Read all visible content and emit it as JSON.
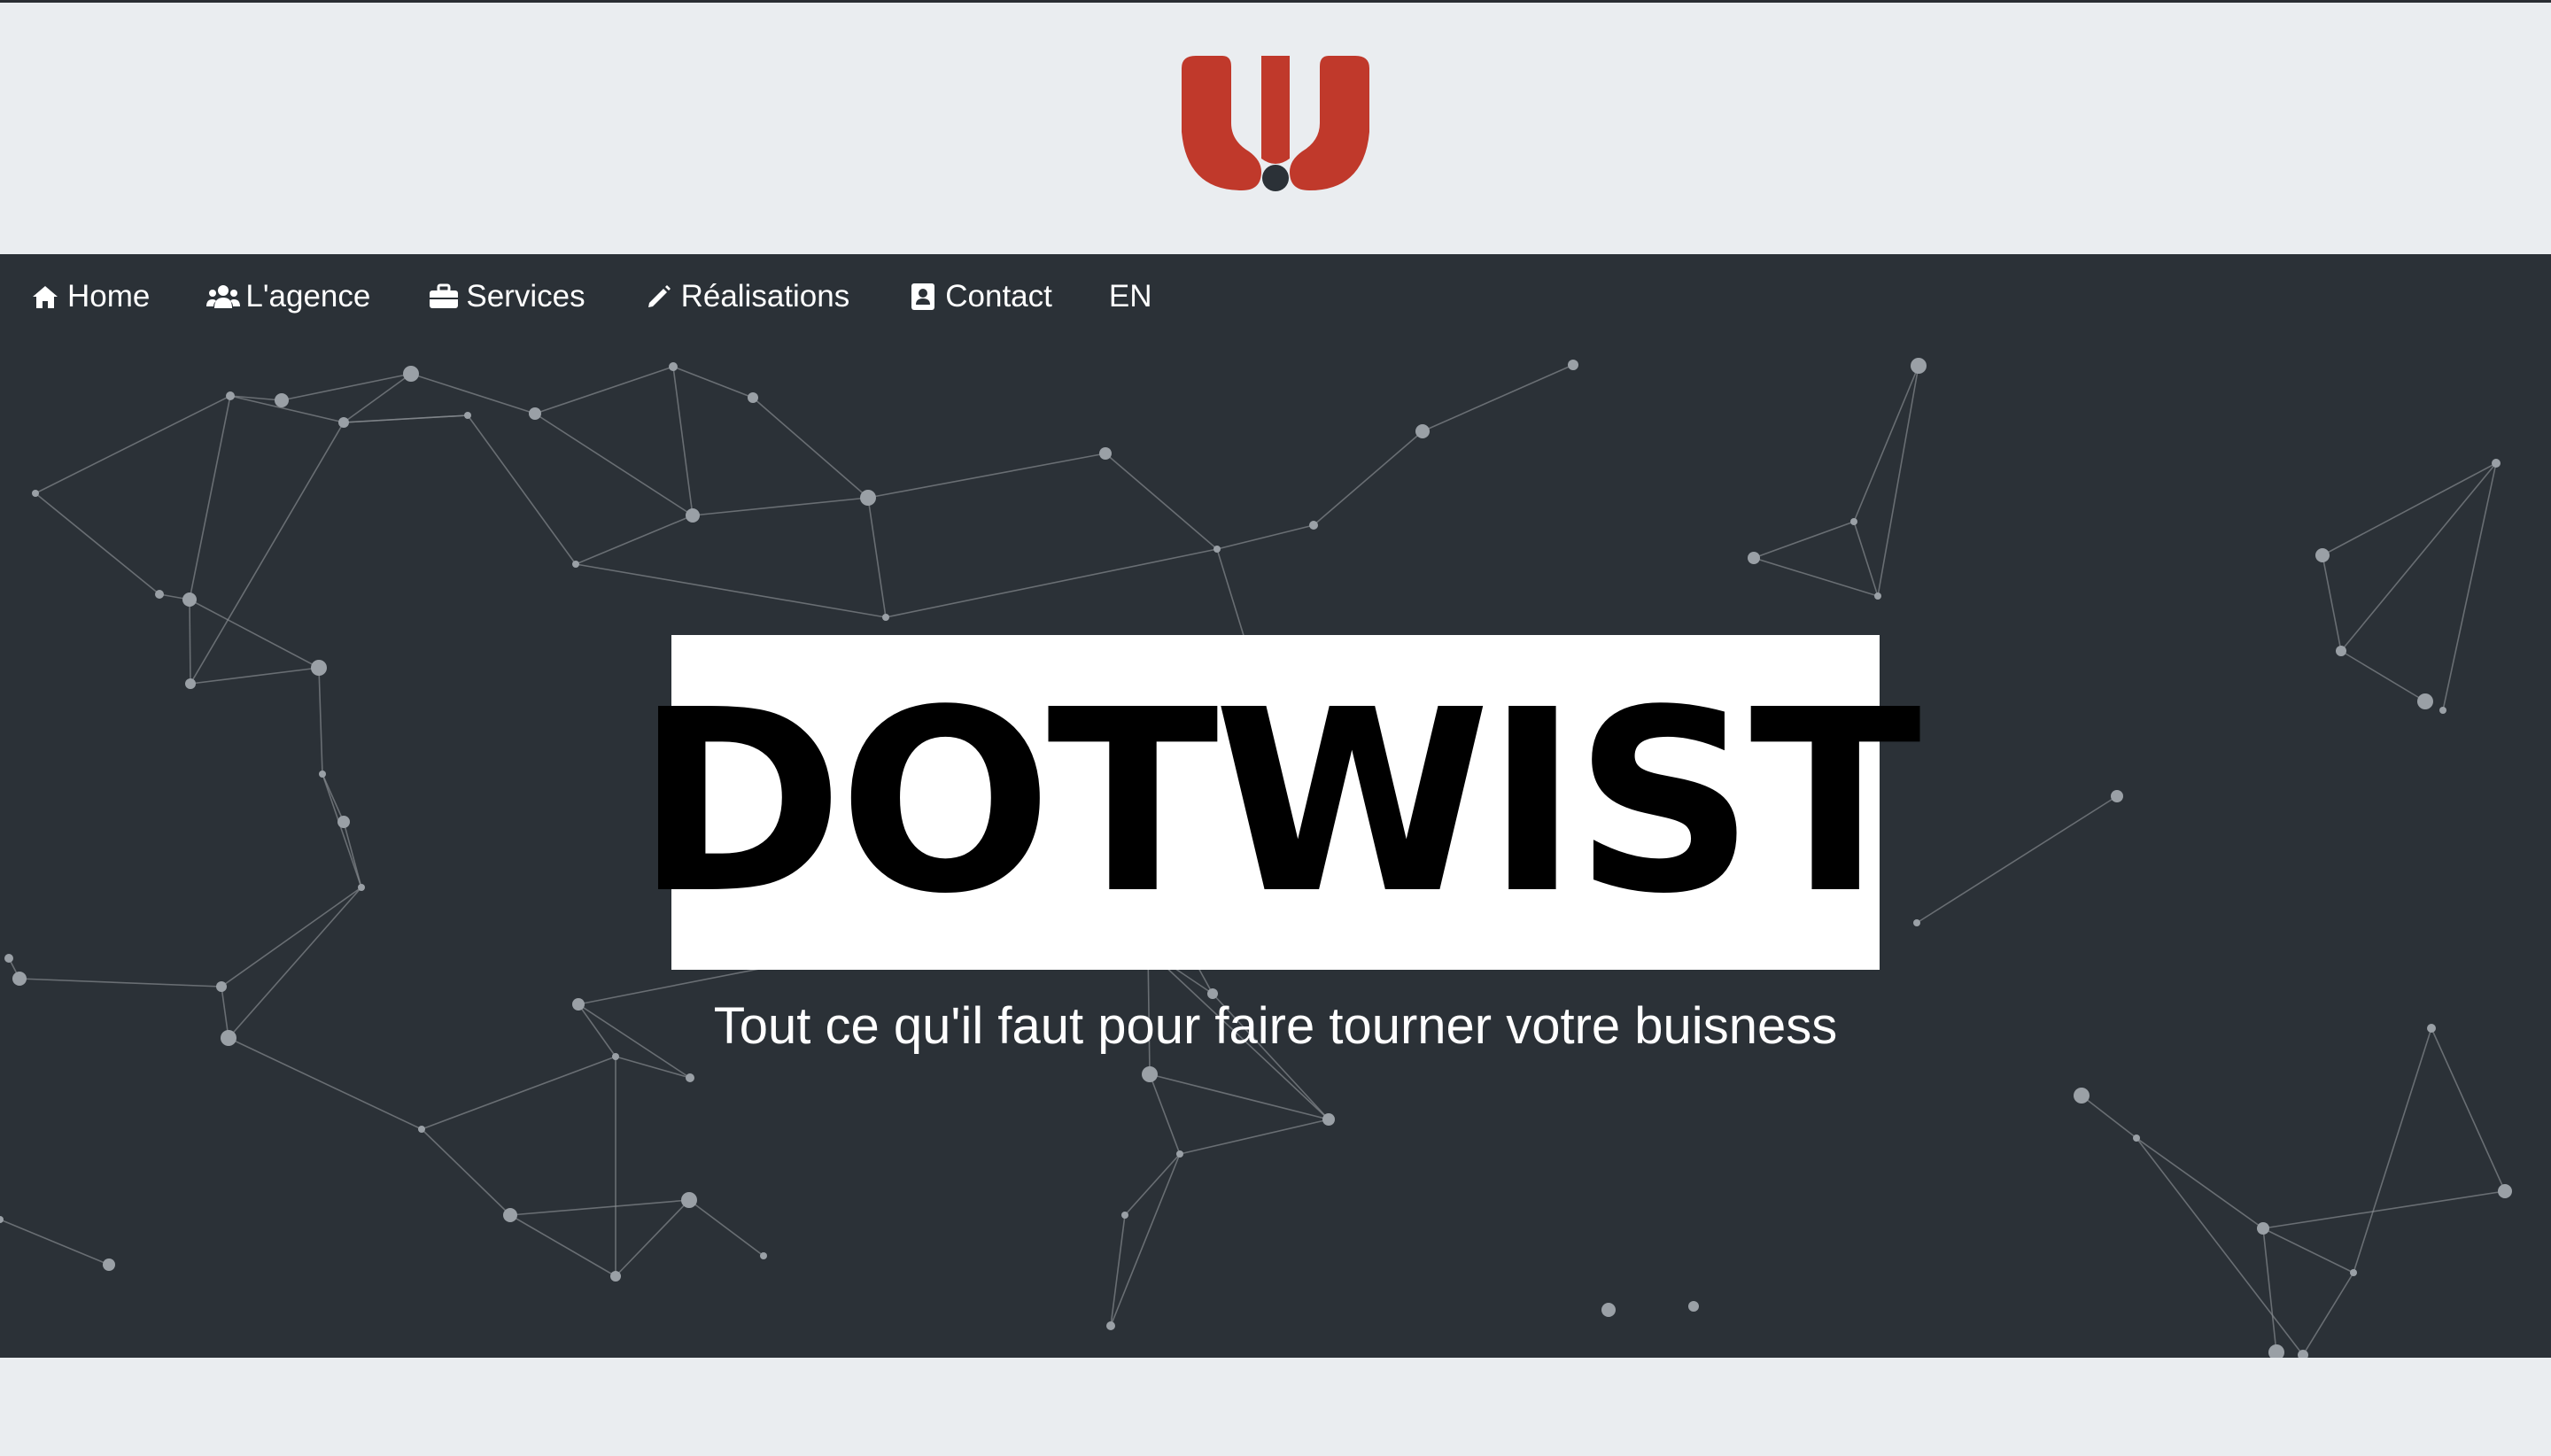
{
  "brand": {
    "logo": "dotwist-w-logo",
    "title": "DOTWIST",
    "tagline": "Tout ce qu'il faut pour faire tourner votre buisness",
    "accent_color": "#c0392b"
  },
  "nav": {
    "items": [
      {
        "label": "Home",
        "icon": "home-icon"
      },
      {
        "label": "L'agence",
        "icon": "users-icon"
      },
      {
        "label": "Services",
        "icon": "briefcase-icon"
      },
      {
        "label": "Réalisations",
        "icon": "pencil-icon"
      },
      {
        "label": "Contact",
        "icon": "contact-card-icon"
      },
      {
        "label": "EN",
        "icon": ""
      }
    ]
  },
  "colors": {
    "hero_background": "#2b3137",
    "page_background": "#eaedf0",
    "network_lines": "#8a8f94"
  }
}
